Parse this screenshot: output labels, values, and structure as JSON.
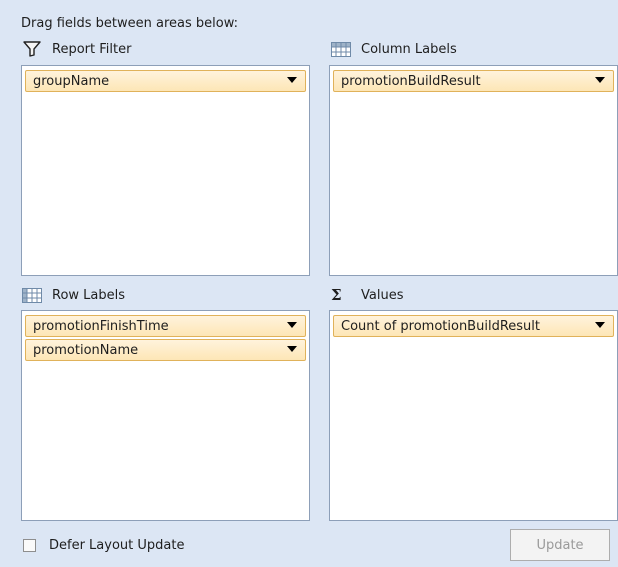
{
  "header": {
    "text": "Drag fields between areas below:"
  },
  "areas": {
    "report_filter": {
      "label": "Report Filter",
      "icon": "filter-icon",
      "fields": [
        "groupName"
      ]
    },
    "column_labels": {
      "label": "Column Labels",
      "icon": "column-grid-icon",
      "fields": [
        "promotionBuildResult"
      ]
    },
    "row_labels": {
      "label": "Row Labels",
      "icon": "row-grid-icon",
      "fields": [
        "promotionFinishTime",
        "promotionName"
      ]
    },
    "values": {
      "label": "Values",
      "icon": "sigma-icon",
      "fields": [
        "Count of promotionBuildResult"
      ]
    }
  },
  "footer": {
    "defer_label": "Defer Layout Update",
    "defer_checked": false,
    "update_label": "Update",
    "update_enabled": false
  },
  "colors": {
    "panel_bg": "#dce6f4",
    "field_border": "#e0b25a",
    "field_fill": "#fde6b6",
    "box_border": "#8d9fb8"
  }
}
